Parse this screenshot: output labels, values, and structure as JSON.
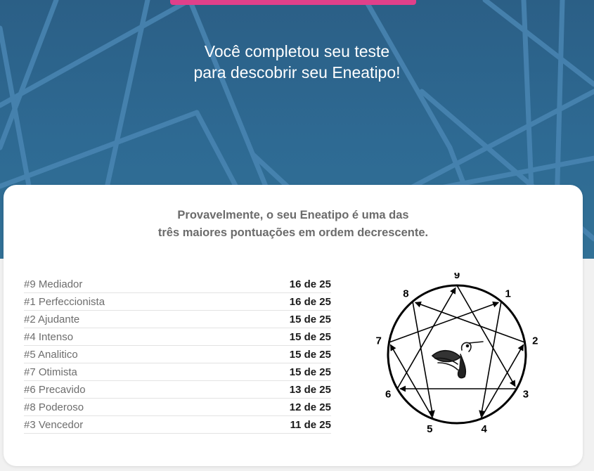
{
  "header": {
    "headline_line1": "Você completou seu teste",
    "headline_line2": "para descobrir seu Eneatipo!"
  },
  "result": {
    "subtitle_line1": "Provavelmente, o seu Eneatipo é uma das",
    "subtitle_line2": "três maiores pontuações em ordem decrescente.",
    "scores": [
      {
        "name": "#9 Mediador",
        "value": "16 de 25"
      },
      {
        "name": "#1 Perfeccionista",
        "value": "16 de 25"
      },
      {
        "name": "#2 Ajudante",
        "value": "15 de 25"
      },
      {
        "name": "#4 Intenso",
        "value": "15 de 25"
      },
      {
        "name": "#5 Analitico",
        "value": "15 de 25"
      },
      {
        "name": "#7 Otimista",
        "value": "15 de 25"
      },
      {
        "name": "#6 Precavido",
        "value": "13 de 25"
      },
      {
        "name": "#8 Poderoso",
        "value": "12 de 25"
      },
      {
        "name": "#3 Vencedor",
        "value": "11 de 25"
      }
    ]
  },
  "enneagram": {
    "points": [
      "9",
      "1",
      "2",
      "3",
      "4",
      "5",
      "6",
      "7",
      "8"
    ],
    "center_icon": "hummingbird-icon"
  },
  "colors": {
    "hero_background": "#2e6a93",
    "accent_button": "#e0408a",
    "card_background": "#ffffff"
  }
}
